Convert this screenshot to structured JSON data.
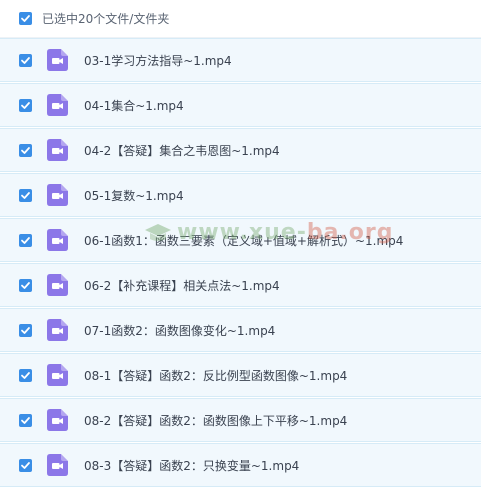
{
  "header": {
    "select_all_checked": true,
    "label": "已选中20个文件/文件夹"
  },
  "colors": {
    "checkbox": "#3a8ee6",
    "row_bg": "#f1f8fd",
    "video_icon": "#8c77e8"
  },
  "files": [
    {
      "name": "03-1学习方法指导~1.mp4",
      "checked": true,
      "icon": "video-file-icon"
    },
    {
      "name": "04-1集合~1.mp4",
      "checked": true,
      "icon": "video-file-icon"
    },
    {
      "name": "04-2【答疑】集合之韦恩图~1.mp4",
      "checked": true,
      "icon": "video-file-icon"
    },
    {
      "name": "05-1复数~1.mp4",
      "checked": true,
      "icon": "video-file-icon"
    },
    {
      "name": "06-1函数1：函数三要素（定义域+值域+解析式）~1.mp4",
      "checked": true,
      "icon": "video-file-icon"
    },
    {
      "name": "06-2【补充课程】相关点法~1.mp4",
      "checked": true,
      "icon": "video-file-icon"
    },
    {
      "name": "07-1函数2：函数图像变化~1.mp4",
      "checked": true,
      "icon": "video-file-icon"
    },
    {
      "name": "08-1【答疑】函数2：反比例型函数图像~1.mp4",
      "checked": true,
      "icon": "video-file-icon"
    },
    {
      "name": "08-2【答疑】函数2：函数图像上下平移~1.mp4",
      "checked": true,
      "icon": "video-file-icon"
    },
    {
      "name": "08-3【答疑】函数2：只换变量~1.mp4",
      "checked": true,
      "icon": "video-file-icon"
    }
  ],
  "watermark": {
    "text_a": "www.xue-",
    "text_b": "ba.org"
  }
}
